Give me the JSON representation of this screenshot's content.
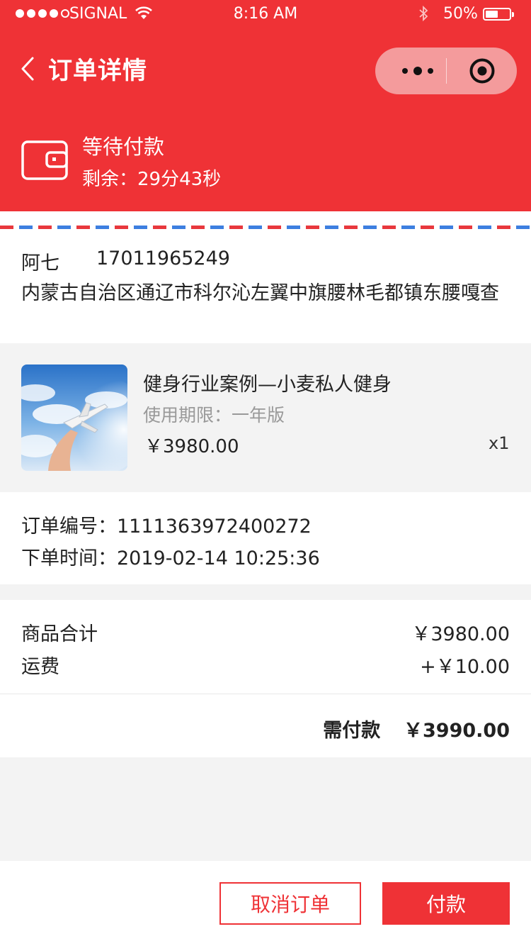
{
  "status_bar": {
    "carrier": "SIGNAL",
    "time": "8:16 AM",
    "battery": "50%",
    "battery_level": 0.5
  },
  "nav": {
    "title": "订单详情",
    "back_icon": "chevron-left-icon",
    "more_icon": "more-dots-icon",
    "close_icon": "target-circle-icon"
  },
  "order_status": {
    "icon": "wallet-icon",
    "title": "等待付款",
    "remaining": "剩余：29分43秒"
  },
  "address": {
    "name": "阿七",
    "phone": "17011965249",
    "line": "内蒙古自治区通辽市科尔沁左翼中旗腰林毛都镇东腰嘎查"
  },
  "product": {
    "name": "健身行业案例—小麦私人健身",
    "spec": "使用期限：一年版",
    "price": "￥3980.00",
    "qty": "x1"
  },
  "order_info": {
    "number": "订单编号：1111363972400272",
    "time": "下单时间：2019-02-14 10:25:36"
  },
  "cost": {
    "subtotal_label": "商品合计",
    "subtotal_value": "￥3980.00",
    "shipping_label": "运费",
    "shipping_value": "+￥10.00",
    "total_label": "需付款",
    "total_value": "￥3990.00"
  },
  "actions": {
    "cancel": "取消订单",
    "pay": "付款"
  },
  "colors": {
    "brand_red": "#ef3236",
    "stripe_blue": "#3d7fe0"
  }
}
